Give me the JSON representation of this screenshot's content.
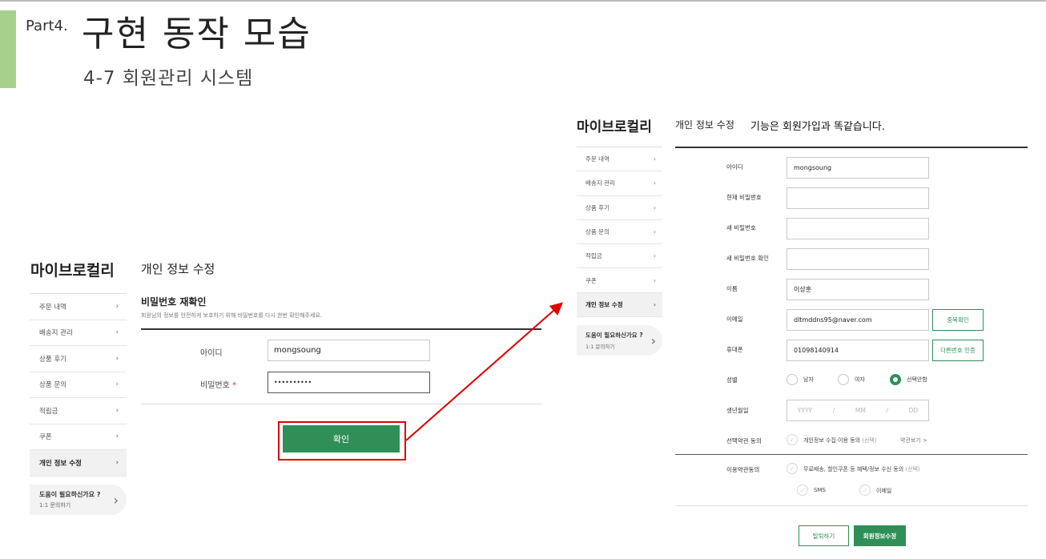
{
  "slide": {
    "part": "Part4.",
    "title": "구현 동작 모습",
    "subtitle": "4-7 회원관리 시스템",
    "accent_color": "#a8d08d"
  },
  "left_screen": {
    "brand": "마이브로컬리",
    "sidebar": [
      {
        "label": "주문 내역"
      },
      {
        "label": "배송지 관리"
      },
      {
        "label": "상품 후기"
      },
      {
        "label": "상품 문의"
      },
      {
        "label": "적립금"
      },
      {
        "label": "쿠폰"
      },
      {
        "label": "개인 정보 수정",
        "active": true
      }
    ],
    "help_title": "도움이 필요하신가요 ?",
    "help_sub": "1:1 문의하기",
    "page_title": "개인 정보 수정",
    "section_title": "비밀번호 재확인",
    "section_desc": "회원님의 정보를 안전하게 보호하기 위해 비밀번호를 다시 한번 확인해주세요.",
    "id_label": "아이디",
    "id_value": "mongsoung",
    "pw_label": "비밀번호",
    "pw_required": "*",
    "pw_value": "••••••••••",
    "confirm_button": "확인",
    "button_color": "#2f8f57",
    "highlight_color": "#e00000"
  },
  "right_screen": {
    "brand": "마이브로컬리",
    "sidebar": [
      {
        "label": "주문 내역"
      },
      {
        "label": "배송지 관리"
      },
      {
        "label": "상품 후기"
      },
      {
        "label": "상품 문의"
      },
      {
        "label": "적립금"
      },
      {
        "label": "쿠폰"
      },
      {
        "label": "개인 정보 수정",
        "active": true
      }
    ],
    "help_title": "도움이 필요하신가요 ?",
    "help_sub": "1:1 문의하기",
    "page_title": "개인 정보 수정",
    "note": "기능은 회원가입과 똑같습니다.",
    "fields": {
      "id": {
        "label": "아이디",
        "value": "mongsoung"
      },
      "current_pw": {
        "label": "현재 비밀번호",
        "value": ""
      },
      "new_pw": {
        "label": "새 비밀번호",
        "value": ""
      },
      "new_pw_confirm": {
        "label": "새 비밀번호 확인",
        "value": ""
      },
      "name": {
        "label": "이름",
        "value": "이상훈"
      },
      "email": {
        "label": "이메일",
        "value": "dltmddns95@naver.com",
        "button": "중복확인"
      },
      "phone": {
        "label": "휴대폰",
        "value": "01098140914",
        "button": "다른번호 인증"
      }
    },
    "gender": {
      "label": "성별",
      "options": [
        "남자",
        "여자",
        "선택안함"
      ],
      "selected": "선택안함"
    },
    "birth": {
      "label": "생년월일",
      "yyyy": "YYYY",
      "mm": "MM",
      "dd": "DD",
      "sep": "/"
    },
    "optional_terms": {
      "label": "선택약관 동의",
      "text": "개인정보 수집·이용 동의",
      "suffix": "(선택)",
      "link": "약관보기 >"
    },
    "terms": {
      "label": "이용약관동의",
      "text": "무료배송, 할인쿠폰 등 혜택/정보 수신 동의",
      "suffix": "(선택)",
      "sms": "SMS",
      "email": "이메일"
    },
    "withdraw_button": "탈퇴하기",
    "save_button": "회원정보수정"
  }
}
